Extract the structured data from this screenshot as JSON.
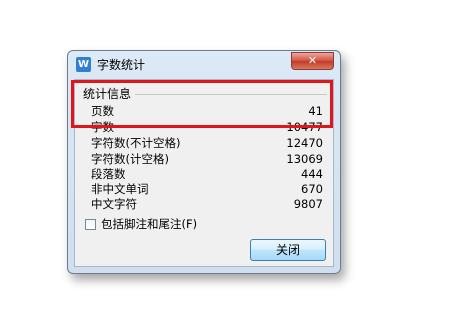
{
  "window": {
    "title": "字数统计",
    "icon_name": "wps-writer-icon",
    "icon_glyph": "W",
    "close_glyph": "✕"
  },
  "stats": {
    "group_label": "统计信息",
    "rows": [
      {
        "label": "页数",
        "value": "41"
      },
      {
        "label": "字数",
        "value": "10477"
      },
      {
        "label": "字符数(不计空格)",
        "value": "12470"
      },
      {
        "label": "字符数(计空格)",
        "value": "13069"
      },
      {
        "label": "段落数",
        "value": "444"
      },
      {
        "label": "非中文单词",
        "value": "670"
      },
      {
        "label": "中文字符",
        "value": "9807"
      }
    ]
  },
  "options": {
    "include_footnotes_label": "包括脚注和尾注(F)",
    "include_footnotes_checked": false
  },
  "buttons": {
    "close_label": "关闭"
  },
  "colors": {
    "highlight": "#e0161c",
    "button_border": "#3c7fb1",
    "title_close": "#c23a28"
  }
}
